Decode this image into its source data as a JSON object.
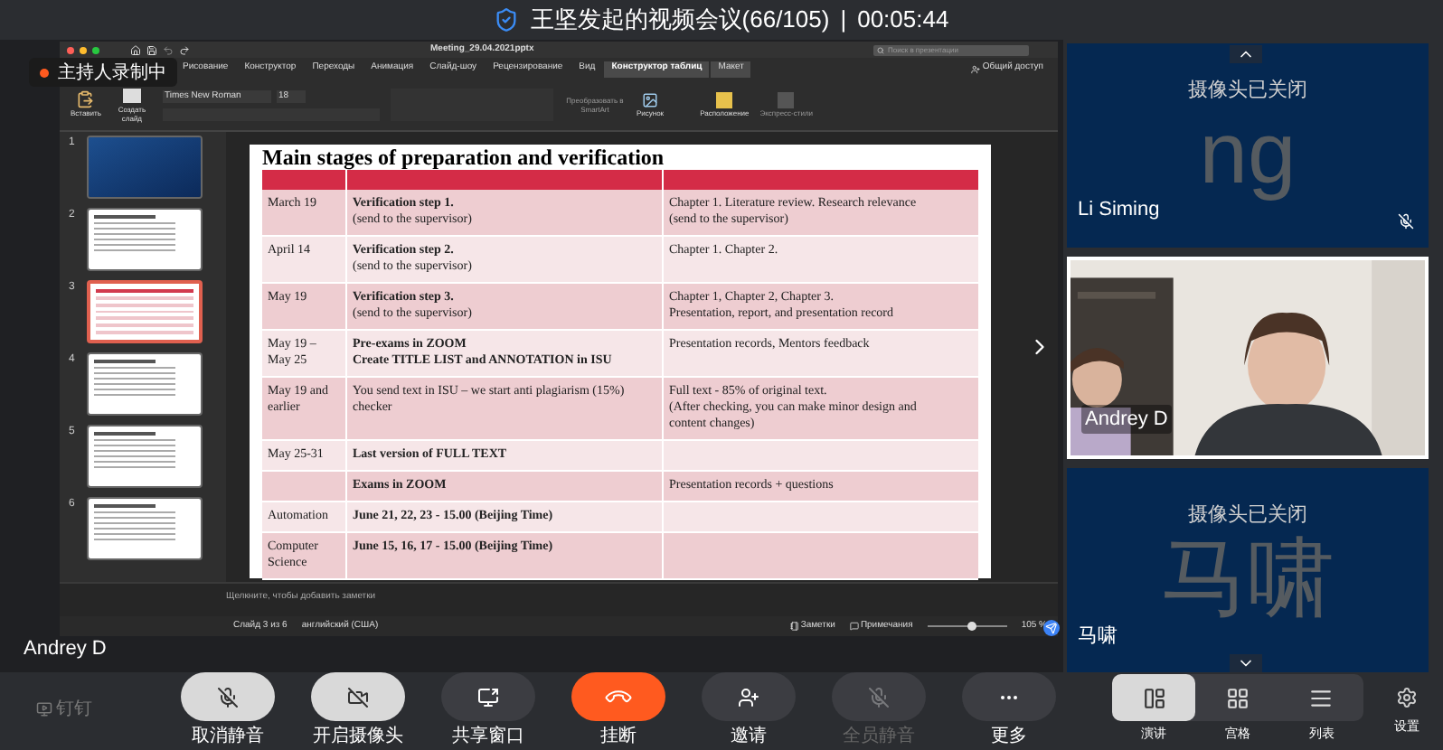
{
  "meeting": {
    "title": "王坚发起的视频会议(66/105)",
    "separator": "|",
    "timer": "00:05:44",
    "recording_badge": "主持人录制中",
    "presenter": "Andrey D"
  },
  "ppt": {
    "file_name": "Meeting_29.04.2021pptx",
    "search": {
      "placeholder": "Поиск в презентации"
    },
    "ribbon_tabs": [
      {
        "label": "Рисование",
        "selected": false,
        "contextual": false
      },
      {
        "label": "Конструктор",
        "selected": false,
        "contextual": false
      },
      {
        "label": "Переходы",
        "selected": false,
        "contextual": false
      },
      {
        "label": "Анимация",
        "selected": false,
        "contextual": false
      },
      {
        "label": "Слайд-шоу",
        "selected": false,
        "contextual": false
      },
      {
        "label": "Рецензирование",
        "selected": false,
        "contextual": false
      },
      {
        "label": "Вид",
        "selected": false,
        "contextual": false
      },
      {
        "label": "Конструктор таблиц",
        "selected": true,
        "contextual": true
      },
      {
        "label": "Макет",
        "selected": false,
        "contextual": true
      }
    ],
    "share": "Общий доступ",
    "toolbar": {
      "paste": "Вставить",
      "new_slide": "Создать слайд",
      "font": "Times New Roman",
      "size": "18",
      "smartart": "Преобразовать в SmartArt",
      "picture": "Рисунок",
      "arrange": "Расположение",
      "quick_styles": "Экспресс-стили"
    },
    "slides": [
      {
        "number": "1",
        "selected": false,
        "kind": "title"
      },
      {
        "number": "2",
        "selected": false,
        "kind": "text"
      },
      {
        "number": "3",
        "selected": true,
        "kind": "table"
      },
      {
        "number": "4",
        "selected": false,
        "kind": "text"
      },
      {
        "number": "5",
        "selected": false,
        "kind": "text"
      },
      {
        "number": "6",
        "selected": false,
        "kind": "text"
      }
    ],
    "slide": {
      "title": "Main stages of preparation and verification",
      "rows": [
        {
          "cells": [
            [
              {
                "t": "March 19",
                "bold": false
              }
            ],
            [
              {
                "t": "Verification step 1.",
                "bold": true
              },
              {
                "t": "(send to the supervisor)",
                "bold": false
              }
            ],
            [
              {
                "t": "Chapter 1. Literature review. Research relevance",
                "bold": false
              },
              {
                "t": "(send to the supervisor)",
                "bold": false
              }
            ]
          ]
        },
        {
          "cells": [
            [
              {
                "t": "April 14",
                "bold": false
              }
            ],
            [
              {
                "t": "Verification step 2.",
                "bold": true
              },
              {
                "t": "(send to the supervisor)",
                "bold": false
              }
            ],
            [
              {
                "t": "Chapter 1. Chapter 2.",
                "bold": false
              }
            ]
          ]
        },
        {
          "cells": [
            [
              {
                "t": "May 19",
                "bold": false
              }
            ],
            [
              {
                "t": "Verification step 3.",
                "bold": true
              },
              {
                "t": "(send to the supervisor)",
                "bold": false
              }
            ],
            [
              {
                "t": "Chapter 1, Chapter 2, Chapter 3.",
                "bold": false
              },
              {
                "t": "Presentation, report, and presentation record",
                "bold": false
              }
            ]
          ]
        },
        {
          "cells": [
            [
              {
                "t": "May 19 –",
                "bold": false
              },
              {
                "t": "May 25",
                "bold": false
              }
            ],
            [
              {
                "t": "Pre-exams in ZOOM",
                "bold": true
              },
              {
                "t": "Create TITLE LIST and ANNOTATION in ISU",
                "bold": true
              }
            ],
            [
              {
                "t": "Presentation records, Mentors feedback",
                "bold": false
              }
            ]
          ]
        },
        {
          "cells": [
            [
              {
                "t": "May 19 and",
                "bold": false
              },
              {
                "t": "earlier",
                "bold": false
              }
            ],
            [
              {
                "t": "You send text in ISU – we start anti plagiarism (15%)",
                "bold": false
              },
              {
                "t": "checker",
                "bold": false
              }
            ],
            [
              {
                "t": "Full text  - 85% of original text.",
                "bold": false
              },
              {
                "t": "(After checking, you can make minor design and",
                "bold": false
              },
              {
                "t": "content changes)",
                "bold": false
              }
            ]
          ]
        },
        {
          "cells": [
            [
              {
                "t": "May 25-31",
                "bold": false
              }
            ],
            [
              {
                "t": "Last version of FULL TEXT",
                "bold": true
              }
            ],
            []
          ]
        },
        {
          "cells": [
            [],
            [
              {
                "t": "Exams in ZOOM",
                "bold": true
              }
            ],
            [
              {
                "t": "Presentation records + questions",
                "bold": false
              }
            ]
          ]
        },
        {
          "cells": [
            [
              {
                "t": "Automation",
                "bold": false
              }
            ],
            [
              {
                "t": "June 21, 22, 23 - 15.00 (Beijing Time)",
                "bold": true
              }
            ],
            []
          ]
        },
        {
          "cells": [
            [
              {
                "t": "Computer",
                "bold": false
              },
              {
                "t": "Science",
                "bold": false
              }
            ],
            [
              {
                "t": "June 15, 16, 17 - 15.00 (Beijing Time)",
                "bold": true
              }
            ],
            []
          ]
        }
      ]
    },
    "notes_placeholder": "Щелкните, чтобы добавить заметки",
    "status": {
      "slide": "Слайд 3 из 6",
      "language": "английский (США)",
      "notes": "Заметки",
      "comments": "Примечания",
      "zoom": "105 %",
      "level": 0.55
    }
  },
  "participants": [
    {
      "name": "Li Siming",
      "kind": "camera_off",
      "avatar_text": "ng",
      "status": "摄像头已关闭",
      "muted": true,
      "selected": false
    },
    {
      "name": "Andrey D",
      "kind": "video",
      "muted": false,
      "selected": true
    },
    {
      "name": "马啸",
      "kind": "camera_off",
      "avatar_text": "马啸",
      "status": "摄像头已关闭",
      "muted": false,
      "selected": false
    }
  ],
  "logo": "钉钉",
  "controls": [
    {
      "label": "取消静音",
      "kind": "mic",
      "disabled": false
    },
    {
      "label": "开启摄像头",
      "kind": "camera",
      "disabled": false
    },
    {
      "label": "共享窗口",
      "kind": "share",
      "disabled": false
    },
    {
      "label": "挂断",
      "kind": "hangup",
      "disabled": false
    },
    {
      "label": "邀请",
      "kind": "invite",
      "disabled": false
    },
    {
      "label": "全员静音",
      "kind": "mute_all",
      "disabled": true
    },
    {
      "label": "更多",
      "kind": "more",
      "disabled": false
    }
  ],
  "views": [
    {
      "label": "演讲",
      "kind": "speaker",
      "selected": true
    },
    {
      "label": "宫格",
      "kind": "grid",
      "selected": false
    },
    {
      "label": "列表",
      "kind": "list",
      "selected": false
    }
  ],
  "settings": "设置"
}
